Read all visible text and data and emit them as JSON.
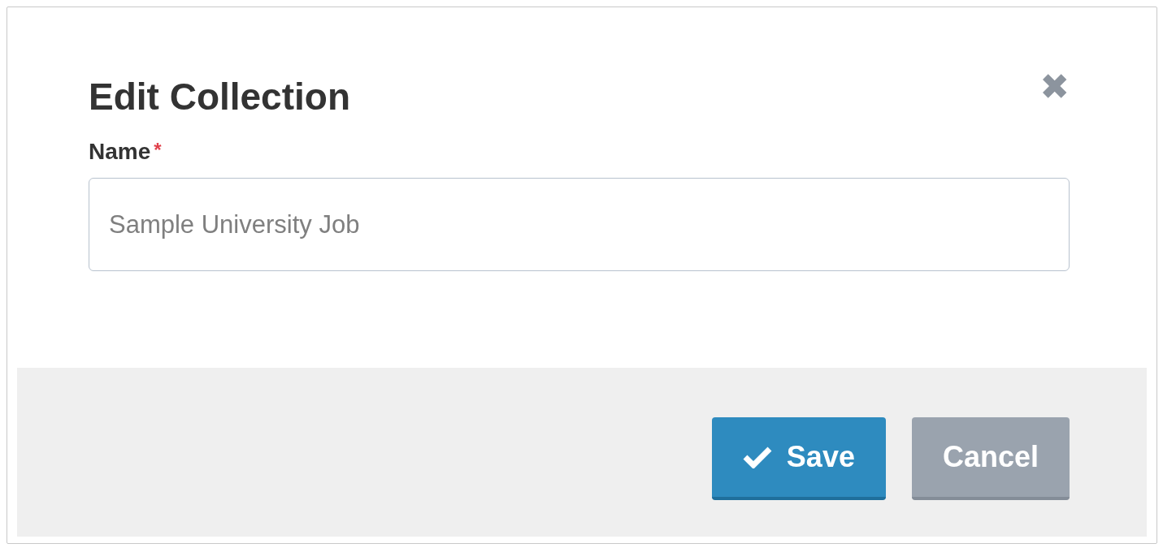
{
  "dialog": {
    "title": "Edit Collection",
    "close_label": "✖"
  },
  "field": {
    "label": "Name",
    "required_mark": "*",
    "value": "Sample University Job"
  },
  "buttons": [
    {
      "kind": "primary",
      "label": "Save"
    },
    {
      "kind": "secondary",
      "label": "Cancel"
    }
  ]
}
